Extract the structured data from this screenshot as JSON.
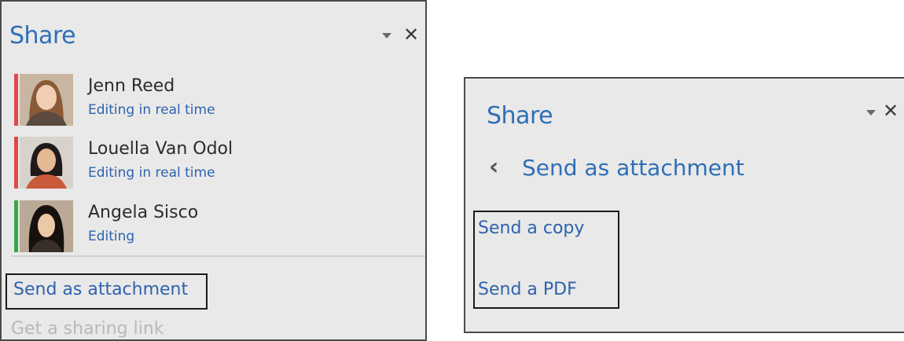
{
  "left_panel": {
    "title": "Share",
    "people": [
      {
        "name": "Jenn Reed",
        "status": "Editing in real time",
        "bar_color": "#e04848"
      },
      {
        "name": "Louella Van Odol",
        "status": "Editing in real time",
        "bar_color": "#e04848"
      },
      {
        "name": "Angela Sisco",
        "status": "Editing",
        "bar_color": "#35a84a"
      }
    ],
    "send_as_attachment": "Send as attachment",
    "get_sharing_link": "Get a sharing link"
  },
  "right_panel": {
    "title": "Share",
    "back_label": "Send as attachment",
    "options": [
      "Send a copy",
      "Send a PDF"
    ]
  },
  "colors": {
    "accent": "#2e6fb7",
    "link": "#2e62ad",
    "panel_bg": "#e9e9e9"
  },
  "icons": [
    "chevron-down-icon",
    "close-icon",
    "back-chevron-icon"
  ]
}
